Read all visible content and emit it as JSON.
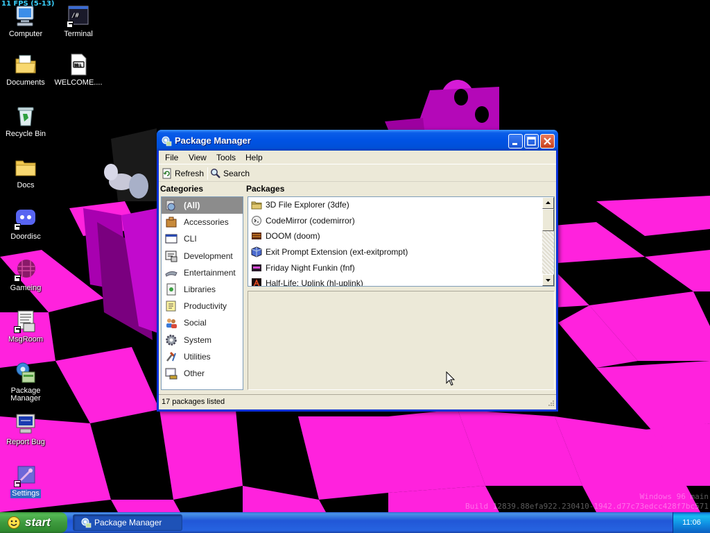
{
  "fps": "11 FPS (5-13)",
  "desktop": {
    "icons": [
      {
        "label": "Computer",
        "icon": "computer-icon"
      },
      {
        "label": "Terminal",
        "icon": "terminal-icon"
      },
      {
        "label": "Documents",
        "icon": "documents-folder-icon"
      },
      {
        "label": "WELCOME....",
        "icon": "markdown-file-icon"
      },
      {
        "label": "Recycle Bin",
        "icon": "recycle-bin-icon"
      },
      {
        "label": "Docs",
        "icon": "folder-icon"
      },
      {
        "label": "Doordisc",
        "icon": "doordisc-icon"
      },
      {
        "label": "Gameing",
        "icon": "game-sphere-icon"
      },
      {
        "label": "MsgRoom",
        "icon": "msgroom-icon"
      },
      {
        "label": "Package Manager",
        "icon": "package-manager-icon"
      },
      {
        "label": "Report Bug",
        "icon": "report-bug-icon"
      },
      {
        "label": "Settings",
        "icon": "settings-icon"
      }
    ],
    "build_line1": "Windows 96 main",
    "build_line2": "Build 12839.88efa922.230410-1942.d77c73edcc428f7bc571"
  },
  "window": {
    "title": "Package Manager",
    "menu": [
      "File",
      "View",
      "Tools",
      "Help"
    ],
    "toolbar": {
      "refresh_label": "Refresh",
      "search_label": "Search"
    },
    "categories_label": "Categories",
    "packages_label": "Packages",
    "categories": [
      {
        "label": "(All)",
        "icon": "all-icon",
        "selected": true
      },
      {
        "label": "Accessories",
        "icon": "accessories-icon"
      },
      {
        "label": "CLI",
        "icon": "cli-icon"
      },
      {
        "label": "Development",
        "icon": "development-icon"
      },
      {
        "label": "Entertainment",
        "icon": "entertainment-icon"
      },
      {
        "label": "Libraries",
        "icon": "libraries-icon"
      },
      {
        "label": "Productivity",
        "icon": "productivity-icon"
      },
      {
        "label": "Social",
        "icon": "social-icon"
      },
      {
        "label": "System",
        "icon": "system-gear-icon"
      },
      {
        "label": "Utilities",
        "icon": "utilities-icon"
      },
      {
        "label": "Other",
        "icon": "other-icon"
      }
    ],
    "packages": [
      {
        "label": "3D File Explorer (3dfe)",
        "icon": "folder-icon"
      },
      {
        "label": "CodeMirror (codemirror)",
        "icon": "codemirror-icon"
      },
      {
        "label": "DOOM (doom)",
        "icon": "doom-icon"
      },
      {
        "label": "Exit Prompt Extension (ext-exitprompt)",
        "icon": "extension-cube-icon"
      },
      {
        "label": "Friday Night Funkin (fnf)",
        "icon": "fnf-icon"
      },
      {
        "label": "Half-Life: Uplink (hl-uplink)",
        "icon": "half-life-icon"
      }
    ],
    "status": "17 packages listed"
  },
  "taskbar": {
    "start_label": "start",
    "task_label": "Package Manager",
    "clock": "11:06"
  },
  "colors": {
    "checker_pink": "#ff22dd",
    "title_blue": "#0053e4",
    "taskbar_blue": "#2157d7",
    "start_green": "#3e9a3e"
  }
}
